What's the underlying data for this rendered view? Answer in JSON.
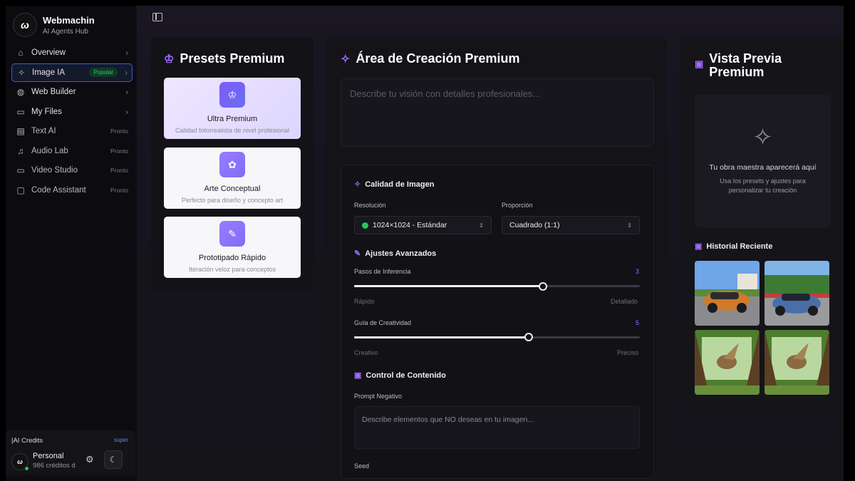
{
  "brand": {
    "title": "Webmachin",
    "subtitle": "AI Agents Hub",
    "logo_icon": "logo-icon"
  },
  "nav": [
    {
      "label": "Overview",
      "icon": "home-icon",
      "chevron": true
    },
    {
      "label": "Image IA",
      "icon": "sparkles-icon",
      "badge": "Popular",
      "chevron": true,
      "active": true
    },
    {
      "label": "Web Builder",
      "icon": "globe-icon",
      "chevron": true
    },
    {
      "label": "My Files",
      "icon": "book-icon",
      "chevron": true
    },
    {
      "label": "Text AI",
      "icon": "document-icon",
      "soon": "Pronto"
    },
    {
      "label": "Audio Lab",
      "icon": "music-icon",
      "soon": "Pronto"
    },
    {
      "label": "Video Studio",
      "icon": "video-icon",
      "soon": "Pronto"
    },
    {
      "label": "Code Assistant",
      "icon": "chat-icon",
      "soon": "Pronto"
    }
  ],
  "credits": {
    "title": "|AI Credits",
    "plan": "super",
    "name": "Personal",
    "amount": "986 créditos d"
  },
  "presets": {
    "title": "Presets Premium",
    "items": [
      {
        "title": "Ultra Premium",
        "desc": "Calidad fotorrealista de nivel profesional",
        "icon": "crown-icon"
      },
      {
        "title": "Arte Conceptual",
        "desc": "Perfecto para diseño y concepto art",
        "icon": "palette-icon"
      },
      {
        "title": "Prototipado Rápido",
        "desc": "Iteración veloz para conceptos",
        "icon": "wand-icon"
      }
    ]
  },
  "create": {
    "title": "Área de Creación Premium",
    "prompt_placeholder": "Describe tu visión con detalles profesionales...",
    "quality_title": "Calidad de Imagen",
    "resolution_label": "Resolución",
    "resolution_value": "1024×1024 - Estándar",
    "ratio_label": "Proporción",
    "ratio_value": "Cuadrado (1:1)",
    "advanced_title": "Ajustes Avanzados",
    "steps_label": "Pasos de Inferencia",
    "steps_value": "3",
    "steps_fraction": 0.66,
    "steps_min": "Rápido",
    "steps_max": "Detallado",
    "guide_label": "Guía de Creatividad",
    "guide_value": "5",
    "guide_fraction": 0.61,
    "guide_min": "Creativo",
    "guide_max": "Preciso",
    "content_title": "Control de Contenido",
    "negative_label": "Prompt Negativo",
    "negative_placeholder": "Describe elementos que NO deseas en tu imagen...",
    "seed_label": "Seed"
  },
  "preview": {
    "title_l1": "Vista Previa",
    "title_l2": "Premium",
    "empty_title": "Tu obra maestra aparecerá aquí",
    "empty_sub_l1": "Usa los presets y ajustes para",
    "empty_sub_l2": "personalizar tu creación",
    "history_title": "Historial Reciente"
  }
}
